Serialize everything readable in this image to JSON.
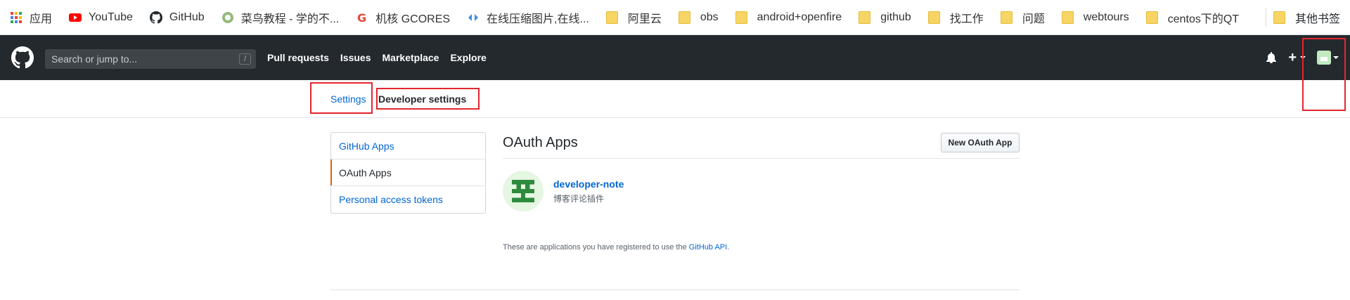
{
  "bookmarks": [
    {
      "label": "应用",
      "icon": "apps-grid-icon"
    },
    {
      "label": "YouTube",
      "icon": "youtube-icon"
    },
    {
      "label": "GitHub",
      "icon": "github-icon"
    },
    {
      "label": "菜鸟教程 - 学的不...",
      "icon": "runoob-icon"
    },
    {
      "label": "机核 GCORES",
      "icon": "gcores-icon"
    },
    {
      "label": "在线压缩图片,在线...",
      "icon": "compress-icon"
    },
    {
      "label": "阿里云",
      "icon": "folder-icon"
    },
    {
      "label": "obs",
      "icon": "folder-icon"
    },
    {
      "label": "android+openfire",
      "icon": "folder-icon"
    },
    {
      "label": "github",
      "icon": "folder-icon"
    },
    {
      "label": "找工作",
      "icon": "folder-icon"
    },
    {
      "label": "问题",
      "icon": "folder-icon"
    },
    {
      "label": "webtours",
      "icon": "folder-icon"
    },
    {
      "label": "centos下的QT",
      "icon": "folder-icon"
    }
  ],
  "other_bookmarks": "其他书签",
  "header": {
    "search_placeholder": "Search or jump to...",
    "slash_key": "/",
    "nav": [
      "Pull requests",
      "Issues",
      "Marketplace",
      "Explore"
    ],
    "plus": "+"
  },
  "subnav": {
    "settings": "Settings",
    "developer_settings": "Developer settings"
  },
  "menu": [
    {
      "label": "GitHub Apps",
      "active": false
    },
    {
      "label": "OAuth Apps",
      "active": true
    },
    {
      "label": "Personal access tokens",
      "active": false
    }
  ],
  "main": {
    "title": "OAuth Apps",
    "new_button": "New OAuth App",
    "app": {
      "name": "developer-note",
      "description": "博客评论插件"
    },
    "footnote_prefix": "These are applications you have registered to use the ",
    "footnote_link": "GitHub API",
    "footnote_suffix": "."
  },
  "colors": {
    "header_bg": "#24292e",
    "link": "#0366d6",
    "highlight_box": "#e3262e",
    "active_marker": "#e36209"
  }
}
